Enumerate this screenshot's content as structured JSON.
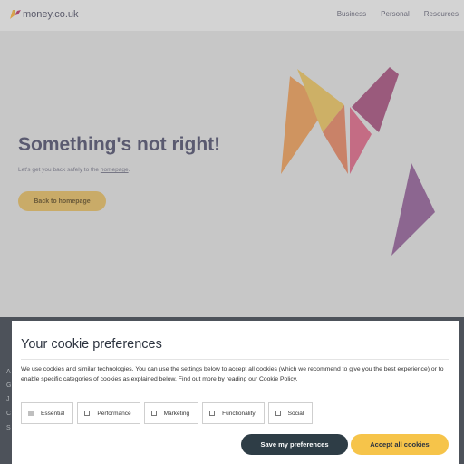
{
  "header": {
    "logo_text": "money.co.uk",
    "nav": [
      "Business",
      "Personal",
      "Resources"
    ]
  },
  "hero": {
    "title": "Something's not right!",
    "subtitle_prefix": "Let's get you back safely to the ",
    "subtitle_link": "homepage",
    "subtitle_suffix": ".",
    "button": "Back to homepage"
  },
  "footer": {
    "fragments": [
      "A",
      "G",
      "J",
      "C",
      "S"
    ]
  },
  "cookie": {
    "title": "Your cookie preferences",
    "text_main": "We use cookies and similar technologies. You can use the settings below to accept all cookies (which we recommend to give you the best experience) or to enable specific categories of cookies as explained below. Find out more by reading our ",
    "policy_link": "Cookie Policy.",
    "options": [
      {
        "label": "Essential",
        "checked": true
      },
      {
        "label": "Performance",
        "checked": false
      },
      {
        "label": "Marketing",
        "checked": false
      },
      {
        "label": "Functionality",
        "checked": false
      },
      {
        "label": "Social",
        "checked": false
      }
    ],
    "save_label": "Save my preferences",
    "accept_label": "Accept all cookies"
  },
  "colors": {
    "accent_yellow": "#f6c44a",
    "dark_button": "#2e3d46",
    "overlay": "#c7c7c7"
  }
}
